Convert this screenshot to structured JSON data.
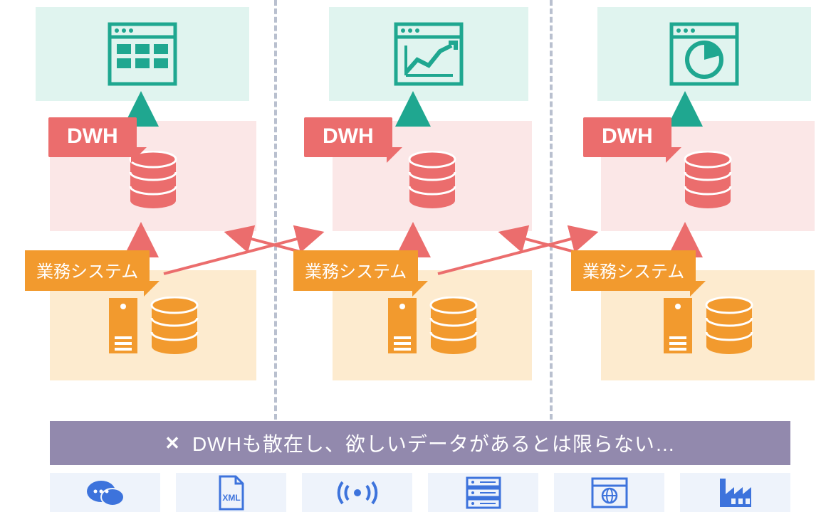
{
  "columns": [
    {
      "dwh": "DWH",
      "system": "業務システム",
      "chart_type": "grid"
    },
    {
      "dwh": "DWH",
      "system": "業務システム",
      "chart_type": "line"
    },
    {
      "dwh": "DWH",
      "system": "業務システム",
      "chart_type": "pie"
    }
  ],
  "banner": {
    "x": "✕",
    "text": "DWHも散在し、欲しいデータがあるとは限らない…"
  },
  "bottom_icons": [
    {
      "name": "chat-icon"
    },
    {
      "name": "xml-file-icon"
    },
    {
      "name": "sensor-icon"
    },
    {
      "name": "server-rack-icon"
    },
    {
      "name": "web-browser-icon"
    },
    {
      "name": "factory-icon"
    }
  ],
  "colors": {
    "teal": "#1fa790",
    "mint": "#e0f4ef",
    "red": "#eb6d6d",
    "pink": "#fbe7e7",
    "orange": "#f29a2e",
    "cream": "#fdebcf",
    "purple": "#9289ad",
    "blue": "#3d73dc",
    "lightblue": "#eef3fb"
  }
}
